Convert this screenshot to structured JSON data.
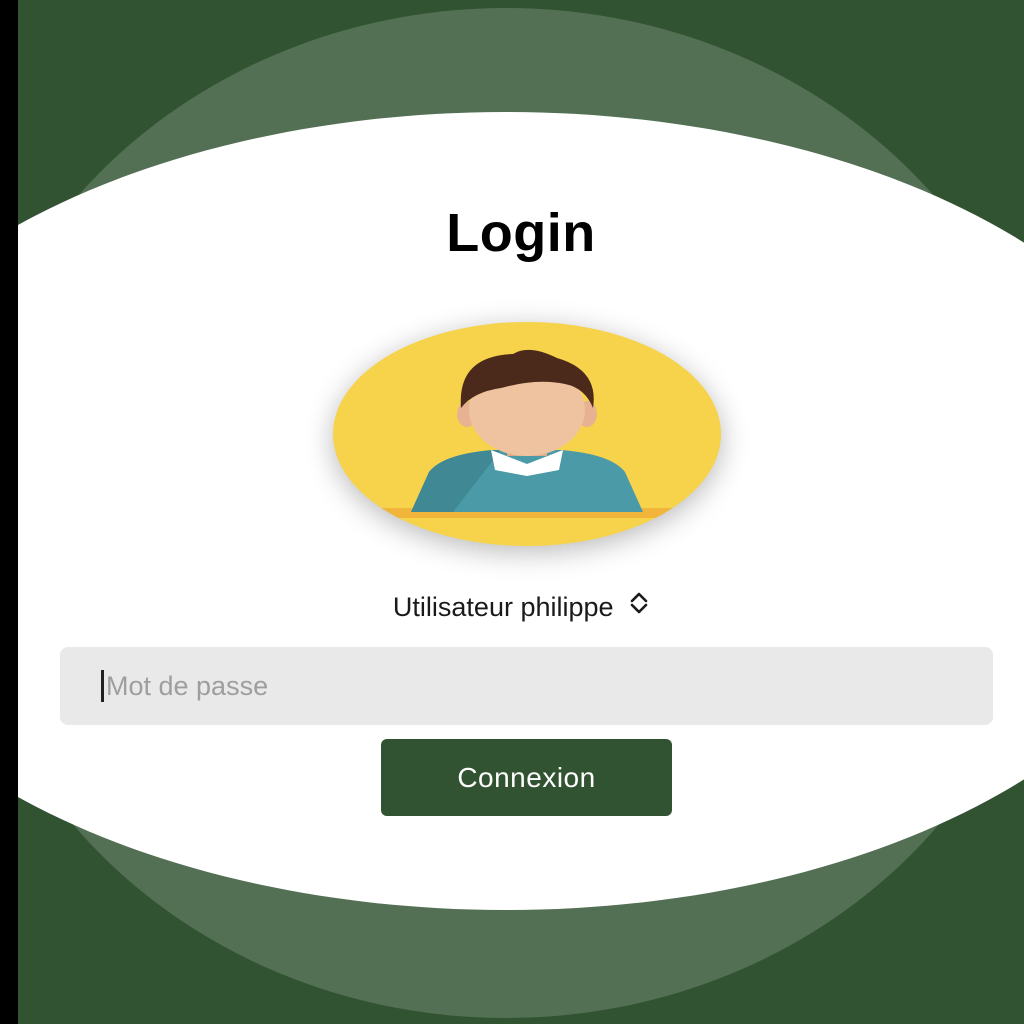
{
  "login": {
    "title": "Login",
    "user_selector_label": "Utilisateur philippe",
    "password_placeholder": "Mot de passe",
    "password_value": "",
    "submit_label": "Connexion"
  },
  "colors": {
    "dark_green": "#325331",
    "mid_green": "#537054",
    "avatar_yellow": "#f6d34a",
    "field_gray": "#e9e9e9"
  },
  "icons": {
    "avatar": "user-avatar-illustration",
    "selector": "chevron-up-down-icon"
  }
}
